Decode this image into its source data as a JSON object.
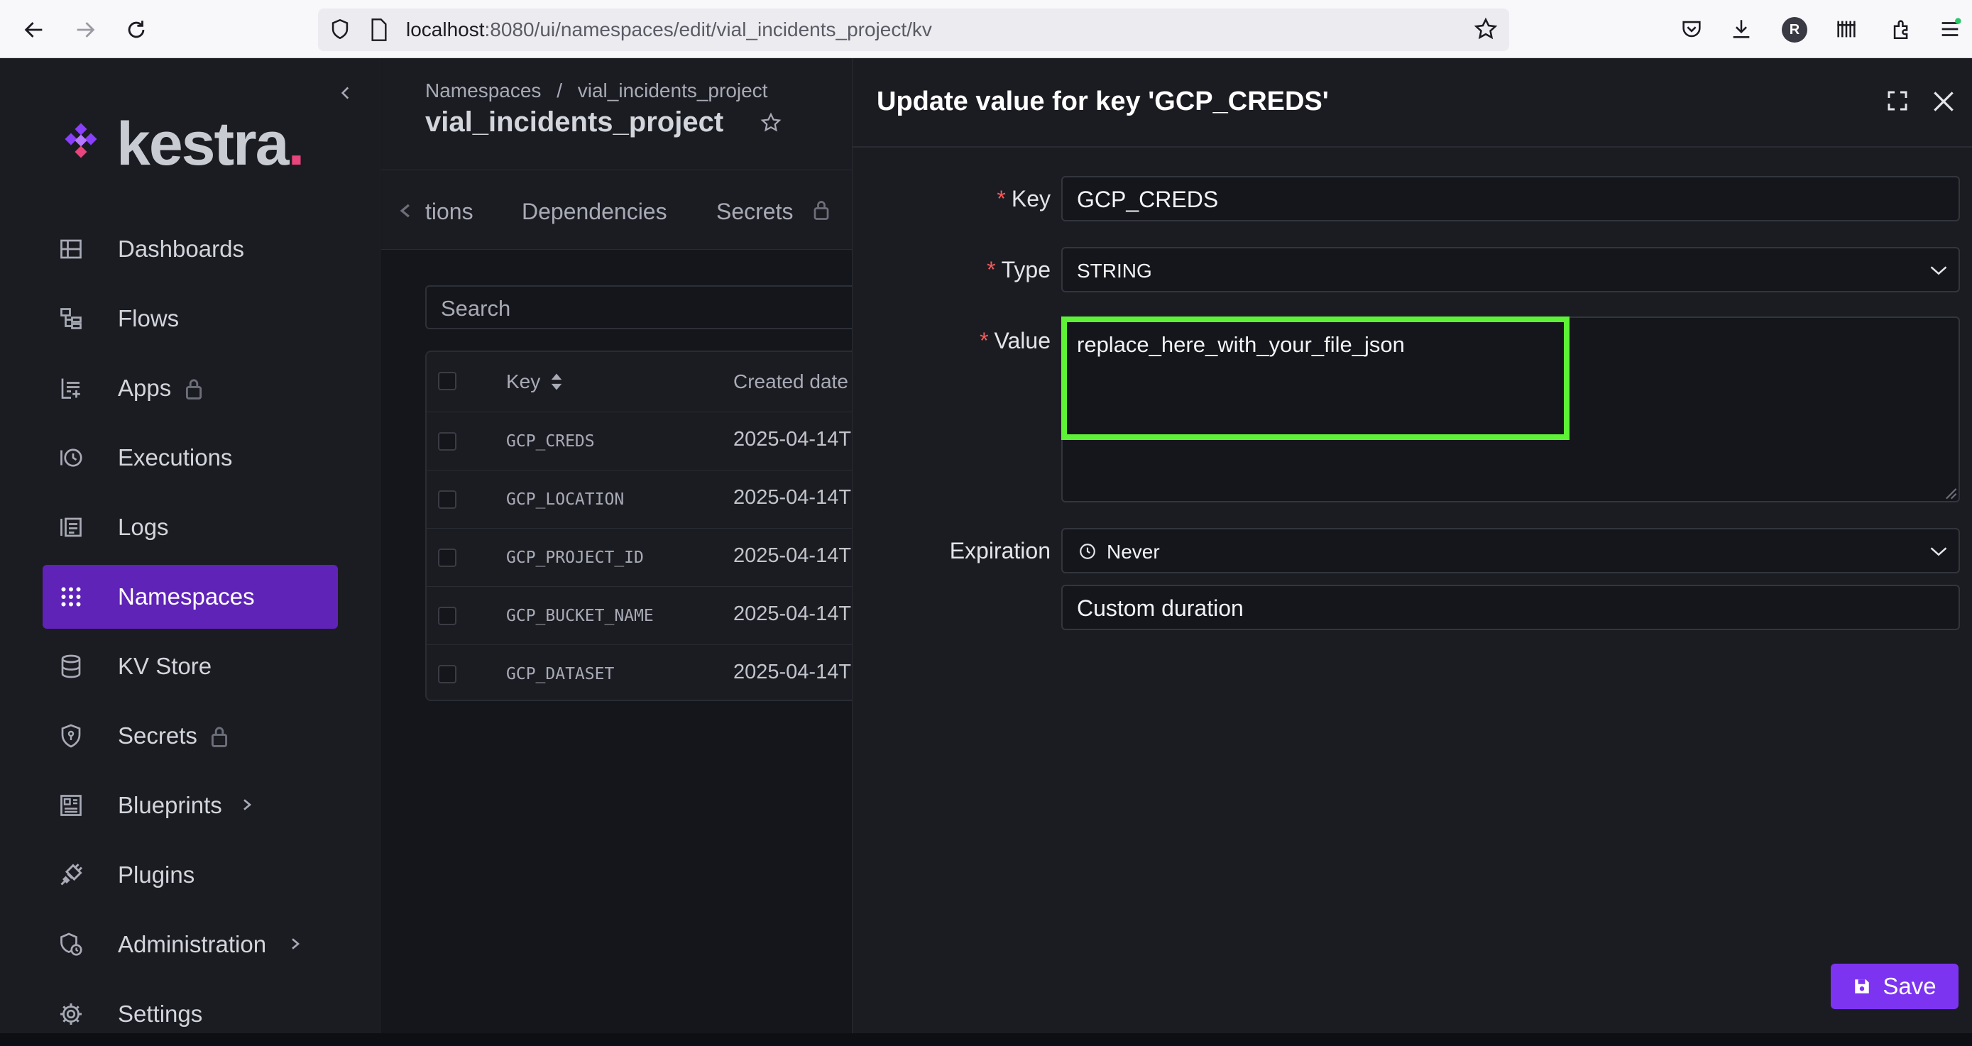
{
  "browser": {
    "url_host": "localhost",
    "url_path": ":8080/ui/namespaces/edit/vial_incidents_project/kv",
    "profile_initial": "R"
  },
  "sidebar": {
    "brand": "kestra",
    "items": [
      {
        "label": "Dashboards",
        "icon": "dashboards-icon"
      },
      {
        "label": "Flows",
        "icon": "flows-icon"
      },
      {
        "label": "Apps",
        "icon": "apps-icon",
        "locked": true
      },
      {
        "label": "Executions",
        "icon": "executions-icon"
      },
      {
        "label": "Logs",
        "icon": "logs-icon"
      },
      {
        "label": "Namespaces",
        "icon": "namespaces-icon",
        "active": true
      },
      {
        "label": "KV Store",
        "icon": "database-icon"
      },
      {
        "label": "Secrets",
        "icon": "shield-icon",
        "locked": true
      },
      {
        "label": "Blueprints",
        "icon": "blueprints-icon",
        "expandable": true
      },
      {
        "label": "Plugins",
        "icon": "plug-icon"
      },
      {
        "label": "Administration",
        "icon": "admin-icon",
        "expandable": true
      },
      {
        "label": "Settings",
        "icon": "gear-icon"
      }
    ]
  },
  "main": {
    "breadcrumb_root": "Namespaces",
    "breadcrumb_sep": "/",
    "breadcrumb_current": "vial_incidents_project",
    "title": "vial_incidents_project",
    "tabs": [
      "tions",
      "Dependencies",
      "Secrets"
    ],
    "search_placeholder": "Search",
    "table": {
      "headers": [
        "Key",
        "Created date"
      ],
      "rows": [
        {
          "key": "GCP_CREDS",
          "created": "2025-04-14T"
        },
        {
          "key": "GCP_LOCATION",
          "created": "2025-04-14T"
        },
        {
          "key": "GCP_PROJECT_ID",
          "created": "2025-04-14T"
        },
        {
          "key": "GCP_BUCKET_NAME",
          "created": "2025-04-14T"
        },
        {
          "key": "GCP_DATASET",
          "created": "2025-04-14T"
        }
      ]
    }
  },
  "drawer": {
    "title": "Update value for key 'GCP_CREDS'",
    "key_label": "Key",
    "key_value": "GCP_CREDS",
    "type_label": "Type",
    "type_value": "STRING",
    "value_label": "Value",
    "value_text": "replace_here_with_your_file_json",
    "expiration_label": "Expiration",
    "expiration_value": "Never",
    "custom_duration": "Custom duration",
    "save_label": "Save",
    "required_mark": "*"
  },
  "colors": {
    "accent": "#7c34f0",
    "active_nav": "#5f23b7",
    "highlight": "#5df236",
    "required": "#f45b5b"
  }
}
